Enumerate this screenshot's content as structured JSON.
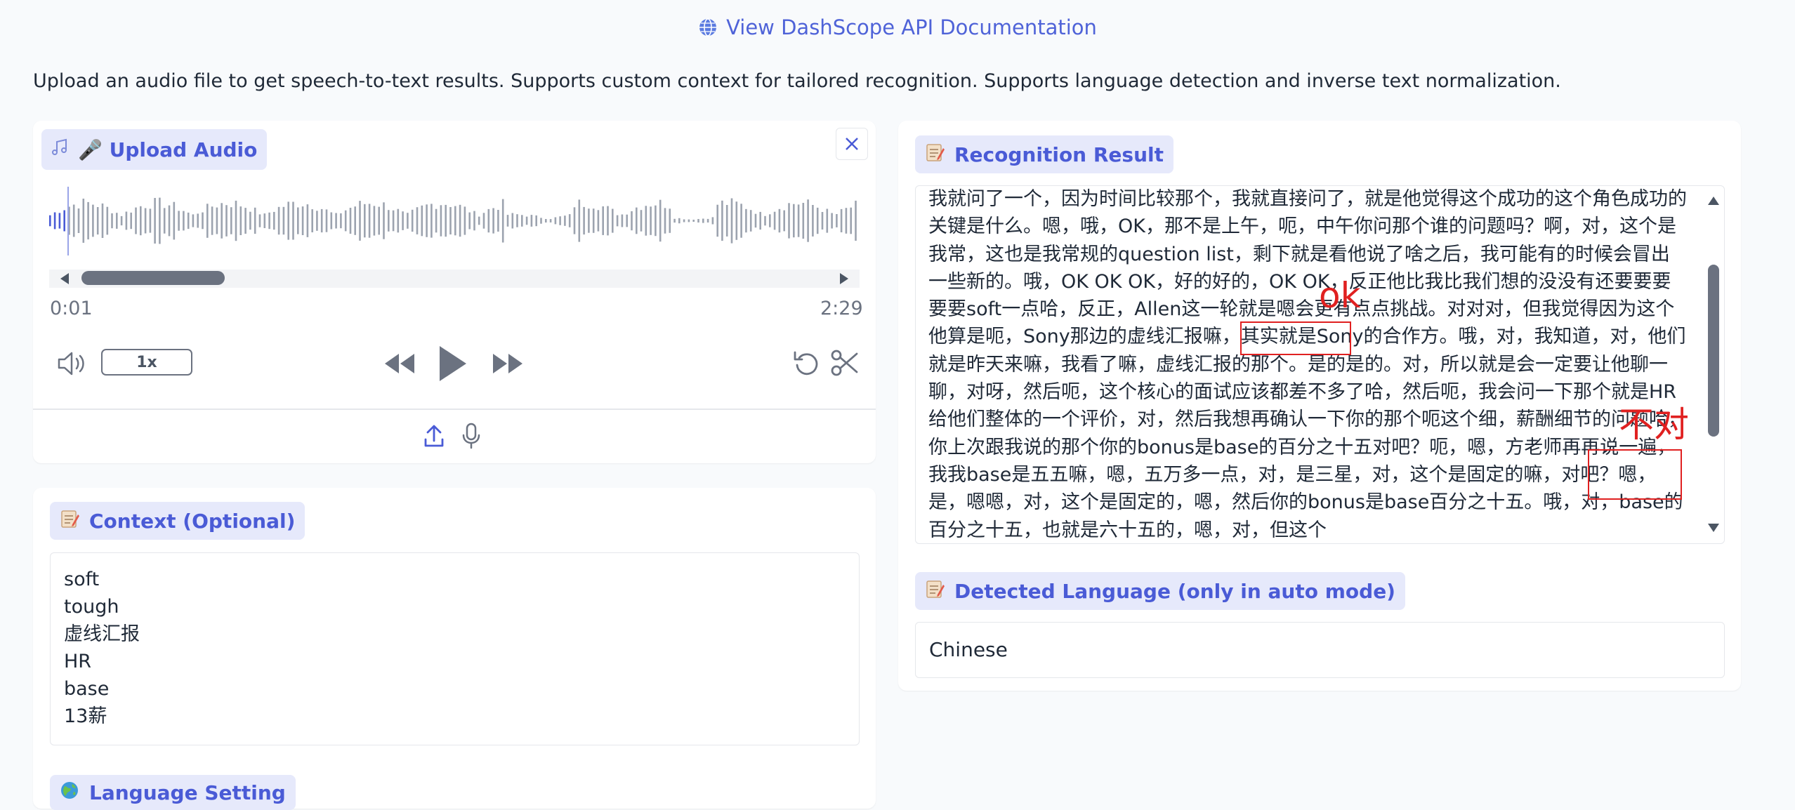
{
  "header": {
    "doc_link": "View DashScope API Documentation",
    "description": "Upload an audio file to get speech-to-text results. Supports custom context for tailored recognition. Supports language detection and inverse text normalization."
  },
  "upload": {
    "label": "🎤 Upload Audio",
    "time_current": "0:01",
    "time_total": "2:29",
    "speed": "1x"
  },
  "context": {
    "label": "Context (Optional)",
    "lines": [
      "soft",
      "tough",
      "虚线汇报",
      "HR",
      "base",
      "13薪"
    ]
  },
  "language_setting": {
    "label": "Language Setting"
  },
  "result": {
    "label": "Recognition Result",
    "text": "我就问了一个，因为时间比较那个，我就直接问了，就是他觉得这个成功的这个角色成功的关键是什么。嗯，哦，OK，那不是上午，呃，中午你问那个谁的问题吗？啊，对，这个是我常，这也是我常规的question list，剩下就是看他说了啥之后，我可能有的时候会冒出一些新的。哦，OK OK OK，好的好的，OK OK，反正他比我比我们想的没没有还要要要要要soft一点哈，反正，Allen这一轮就是嗯会更有点点挑战。对对对，但我觉得因为这个他算是呃，Sony那边的虚线汇报嘛，其实就是Sony的合作方。哦，对，我知道，对，他们就是昨天来嘛，我看了嘛，虚线汇报的那个。是的是的。对，所以就是会一定要让他聊一聊，对呀，然后呃，这个核心的面试应该都差不多了哈，然后呃，我会问一下那个就是HR给他们整体的一个评价，对，然后我想再确认一下你的那个呃这个细，薪酬细节的问题哈，你上次跟我说的那个你的bonus是base的百分之十五对吧？呃，嗯，方老师再再说一遍，我我base是五五嘛，嗯，五万多一点，对，是三星，对，这个是固定的嘛，对吧？嗯，是，嗯嗯，对，这个是固定的，嗯，然后你的bonus是base百分之十五。哦，对，base的百分之十五，也就是六十五的，嗯，对，但这个"
  },
  "detected": {
    "label": "Detected Language (only in auto mode)",
    "value": "Chinese"
  },
  "annotations": {
    "ok": "ok",
    "wrong": "不对"
  },
  "colors": {
    "accent": "#4a5bd6",
    "chip_bg": "#e6e9fb",
    "annotation": "#e02020"
  }
}
